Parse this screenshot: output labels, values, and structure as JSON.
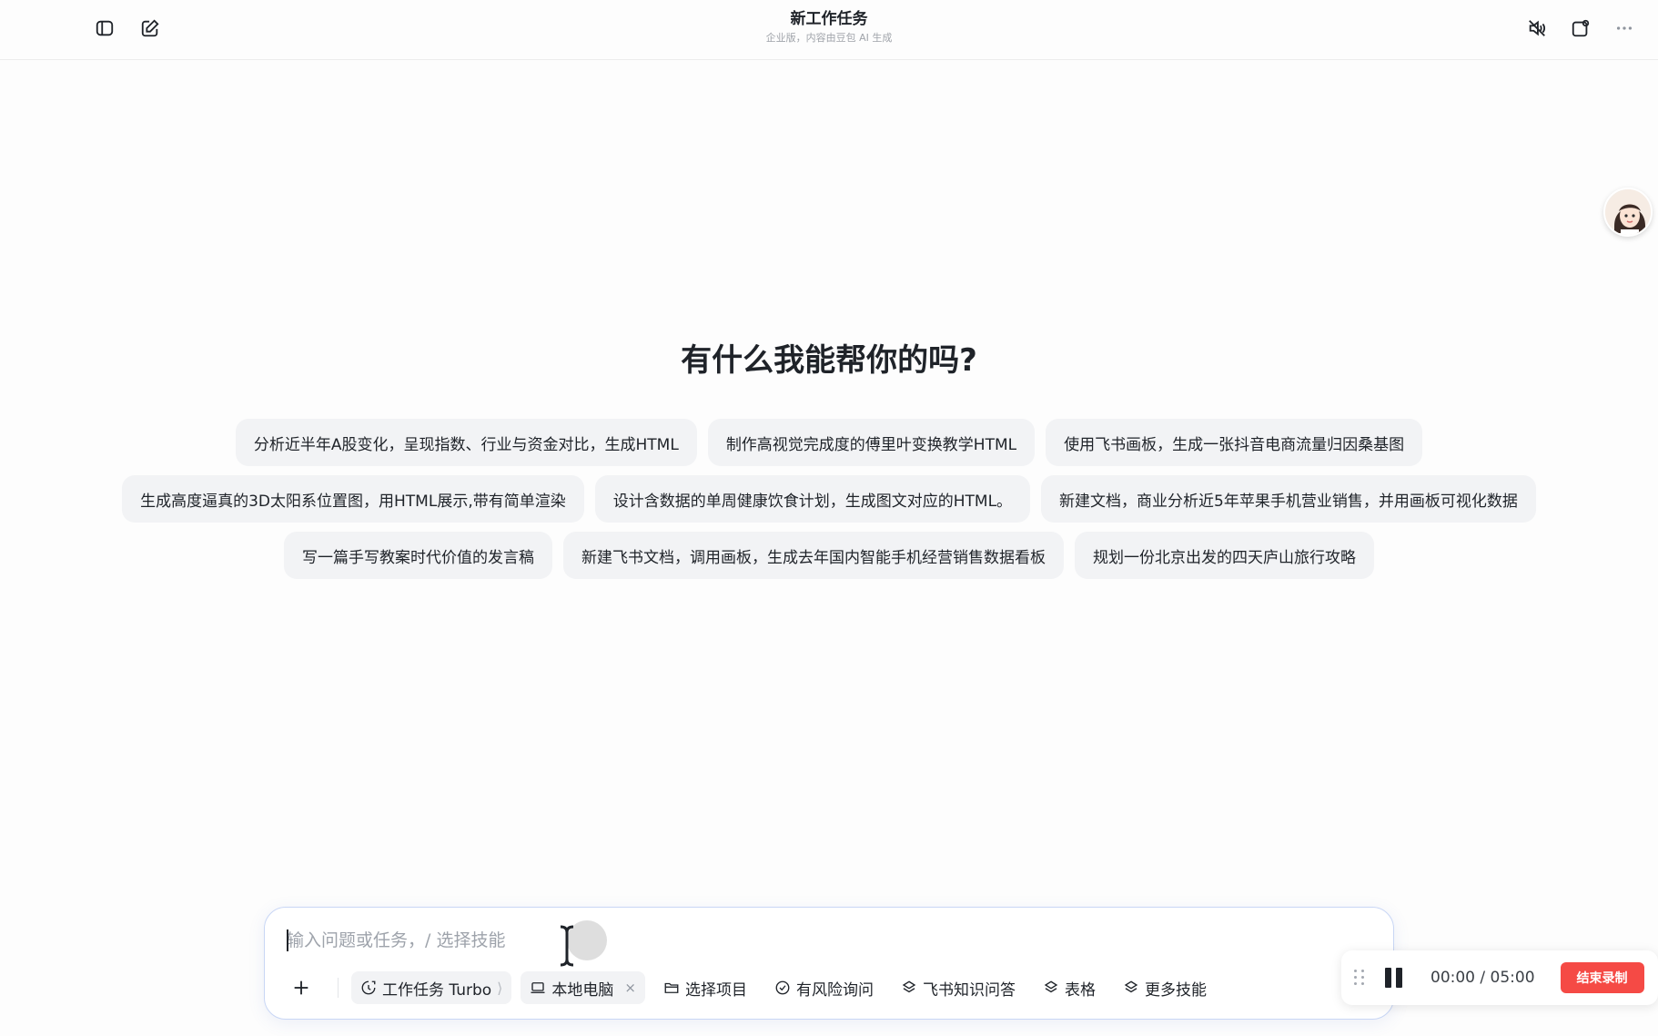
{
  "header": {
    "title": "新工作任务",
    "subtitle": "企业版，内容由豆包 AI 生成"
  },
  "main": {
    "heading": "有什么我能帮你的吗?",
    "suggestions": [
      [
        "分析近半年A股变化，呈现指数、行业与资金对比，生成HTML",
        "制作高视觉完成度的傅里叶变换教学HTML",
        "使用飞书画板，生成一张抖音电商流量归因桑基图"
      ],
      [
        "生成高度逼真的3D太阳系位置图，用HTML展示,带有简单渲染",
        "设计含数据的单周健康饮食计划，生成图文对应的HTML。",
        "新建文档，商业分析近5年苹果手机营业销售，并用画板可视化数据"
      ],
      [
        "写一篇手写教案时代价值的发言稿",
        "新建飞书文档，调用画板，生成去年国内智能手机经营销售数据看板",
        "规划一份北京出发的四天庐山旅行攻略"
      ]
    ]
  },
  "input": {
    "placeholder": "输入问题或任务，/ 选择技能",
    "value": ""
  },
  "toolbar": {
    "mode_label": "工作任务 Turbo",
    "mode_sep": "⟩",
    "device_label": "本地电脑",
    "device_close": "×",
    "project_label": "选择项目",
    "risk_label": "有风险询问",
    "knowledge_label": "飞书知识问答",
    "sheet_label": "表格",
    "more_label": "更多技能"
  },
  "recording": {
    "elapsed": "00:00",
    "separator": "/",
    "limit": "05:00",
    "end_label": "结束录制"
  },
  "colors": {
    "accent_red": "#f54a45",
    "input_border": "#c8d6f5",
    "chip_bg": "#f2f3f5"
  }
}
